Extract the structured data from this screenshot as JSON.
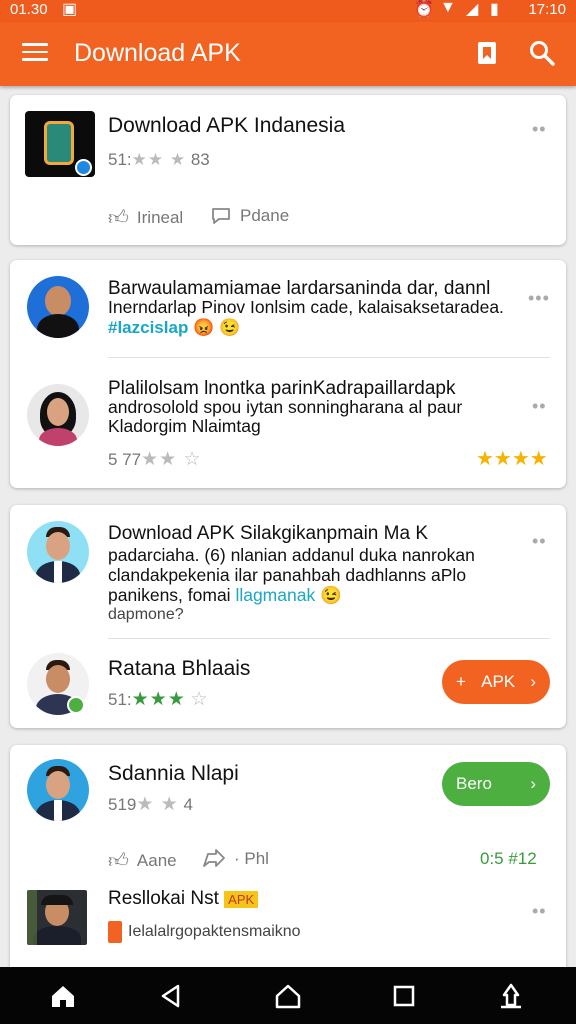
{
  "status": {
    "time_left": "01.30",
    "time_right": "17:10"
  },
  "appbar": {
    "title": "Download APK"
  },
  "card1": {
    "title": "Download APK Indanesia",
    "meta_prefix": "51:",
    "meta_suffix": "83",
    "stars": "★★ ★",
    "like_label": "Irineal",
    "comment_label": "Pdane"
  },
  "card2": {
    "post1": {
      "line1": "Barwaulamamiamae lardarsaninda dar, dannl",
      "line2": "Inerndarlap Pinov Ionlsim cade, kalaisaksetaradea.",
      "hashtag": "#lazcislap",
      "emojis": "😡 😉"
    },
    "post2": {
      "line1": "Plalilolsam lnontka parinKadrapaillardapk",
      "line2": "androsolold spou iytan sonningharana al paur",
      "line3": "Kladorgim Nlaimtag",
      "meta": "5 77",
      "stars": "★★ ☆",
      "rating_stars": "★★★★"
    }
  },
  "card3": {
    "post1": {
      "title": "Download APK Silakgikanpmain Ma K",
      "line2": "padarciaha. (6) nlanian addanul duka nanrokan",
      "line3": "clandakpekenia ilar panahbah dadhlanns aPlo",
      "line4_start": "panikens, fomai ",
      "line4_link": "llagmanak",
      "line4_emoji": "😉",
      "line5": "dapmone?"
    },
    "post2": {
      "title": "Ratana Bhlaais",
      "meta": "51:",
      "stars": "★★★",
      "empty_star": "☆",
      "button_label": "APK"
    }
  },
  "card4": {
    "title": "Sdannia Nlapi",
    "meta": "519",
    "stars": "★ ★",
    "meta_suffix": "4",
    "button_label": "Bero",
    "like_label": "Aane",
    "share_label": "· Phl",
    "counter": "0:5 #12",
    "sub_title": "Resllokai Nst",
    "badge": "APK",
    "sub_line": "Ielalalrgopaktensmaikno"
  },
  "colors": {
    "accent": "#f26322",
    "green": "#4caf3f",
    "teal": "#1aa7c7"
  },
  "icons": [
    "menu-icon",
    "bookmark-icon",
    "search-icon",
    "thumbs-up-icon",
    "comment-icon",
    "share-icon",
    "more-icon",
    "home-icon",
    "back-icon",
    "recents-icon"
  ]
}
